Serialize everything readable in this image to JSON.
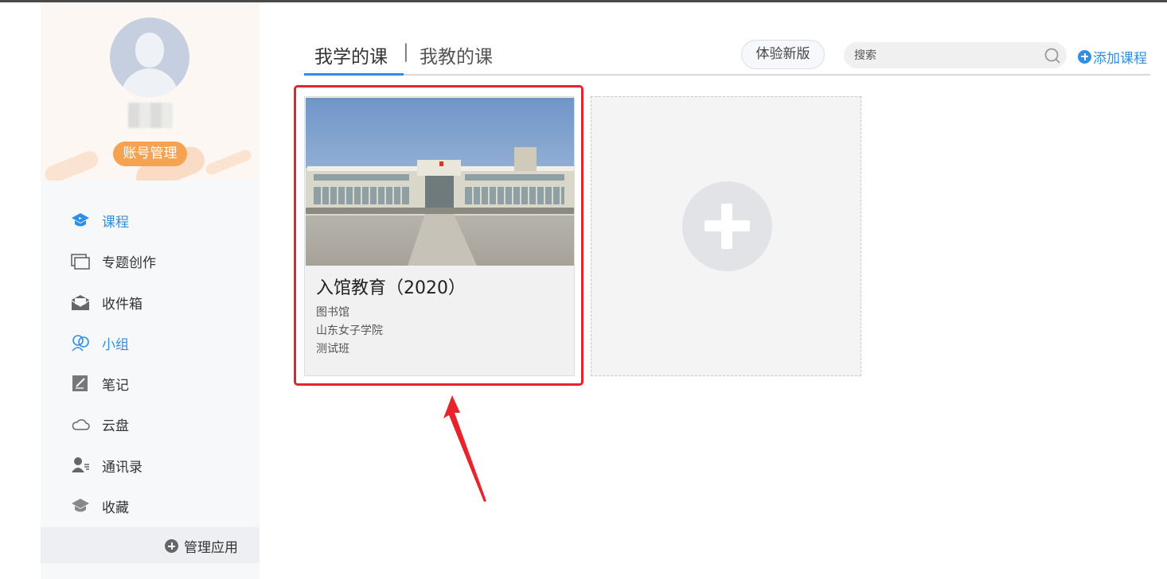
{
  "sidebar": {
    "account_button": "账号管理",
    "nav": [
      {
        "label": "课程",
        "icon": "course-icon",
        "active": true
      },
      {
        "label": "专题创作",
        "icon": "topic-create-icon",
        "active": false
      },
      {
        "label": "收件箱",
        "icon": "inbox-icon",
        "active": false
      },
      {
        "label": "小组",
        "icon": "group-icon",
        "active": true
      },
      {
        "label": "笔记",
        "icon": "note-icon",
        "active": false
      },
      {
        "label": "云盘",
        "icon": "cloud-icon",
        "active": false
      },
      {
        "label": "通讯录",
        "icon": "contacts-icon",
        "active": false
      },
      {
        "label": "收藏",
        "icon": "favorites-icon",
        "active": false
      }
    ],
    "manage_apps": "管理应用"
  },
  "header": {
    "tab_learn": "我学的课",
    "tab_separator": "|",
    "tab_teach": "我教的课",
    "active_tab": "我学的课",
    "try_new_button": "体验新版",
    "search_placeholder": "搜索",
    "add_course": "添加课程"
  },
  "courses": [
    {
      "title": "入馆教育（2020）",
      "department": "图书馆",
      "school": "山东女子学院",
      "class": "测试班"
    }
  ],
  "colors": {
    "accent": "#2e8fe5",
    "account_button": "#f5a251",
    "highlight": "#e8232a"
  }
}
